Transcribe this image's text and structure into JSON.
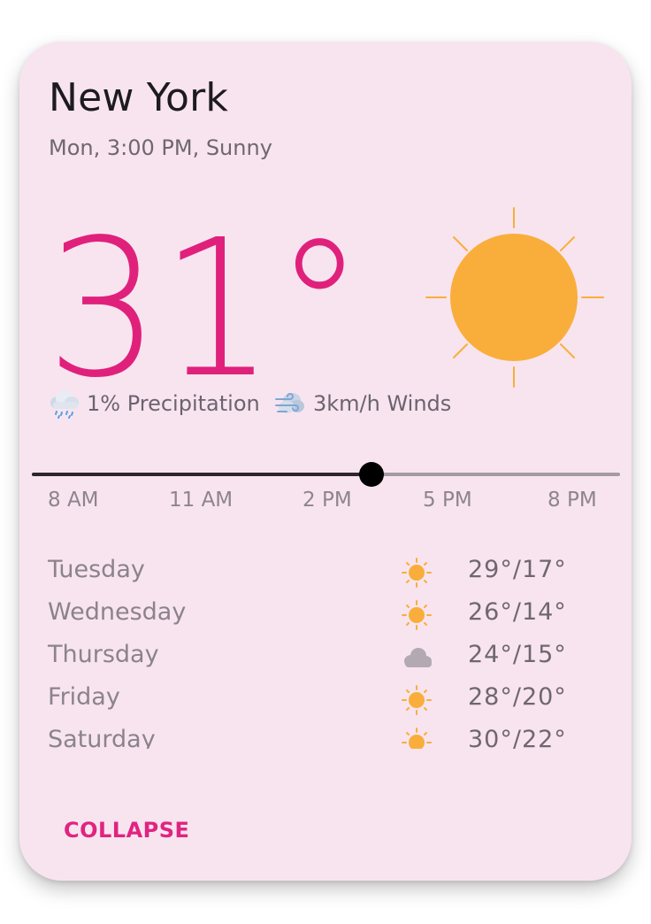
{
  "card": {
    "city": "New York",
    "subtitle": "Mon, 3:00 PM, Sunny",
    "temperature": "31°",
    "current_icon": "sun-icon",
    "metrics": {
      "precipitation": {
        "icon": "rain-cloud-icon",
        "label": "1% Precipitation"
      },
      "wind": {
        "icon": "wind-icon",
        "label": "3km/h Winds"
      }
    }
  },
  "timeline": {
    "ticks": [
      "8 AM",
      "11 AM",
      "2 PM",
      "5 PM",
      "8 PM"
    ],
    "value_fraction": 0.578
  },
  "forecast": [
    {
      "day": "Tuesday",
      "icon": "sun-icon",
      "range": "29°/17°"
    },
    {
      "day": "Wednesday",
      "icon": "sun-icon",
      "range": "26°/14°"
    },
    {
      "day": "Thursday",
      "icon": "cloud-icon",
      "range": "24°/15°"
    },
    {
      "day": "Friday",
      "icon": "sun-icon",
      "range": "28°/20°"
    },
    {
      "day": "Saturday",
      "icon": "sun-icon",
      "range": "30°/22°"
    }
  ],
  "actions": {
    "collapse": "COLLAPSE"
  },
  "colors": {
    "card_bg": "#f8e4ef",
    "accent": "#e02480",
    "sun": "#f9ae3b",
    "cloud": "#b3a9b2",
    "track_filled": "#2b272a",
    "track_rest": "#a49aa1"
  }
}
